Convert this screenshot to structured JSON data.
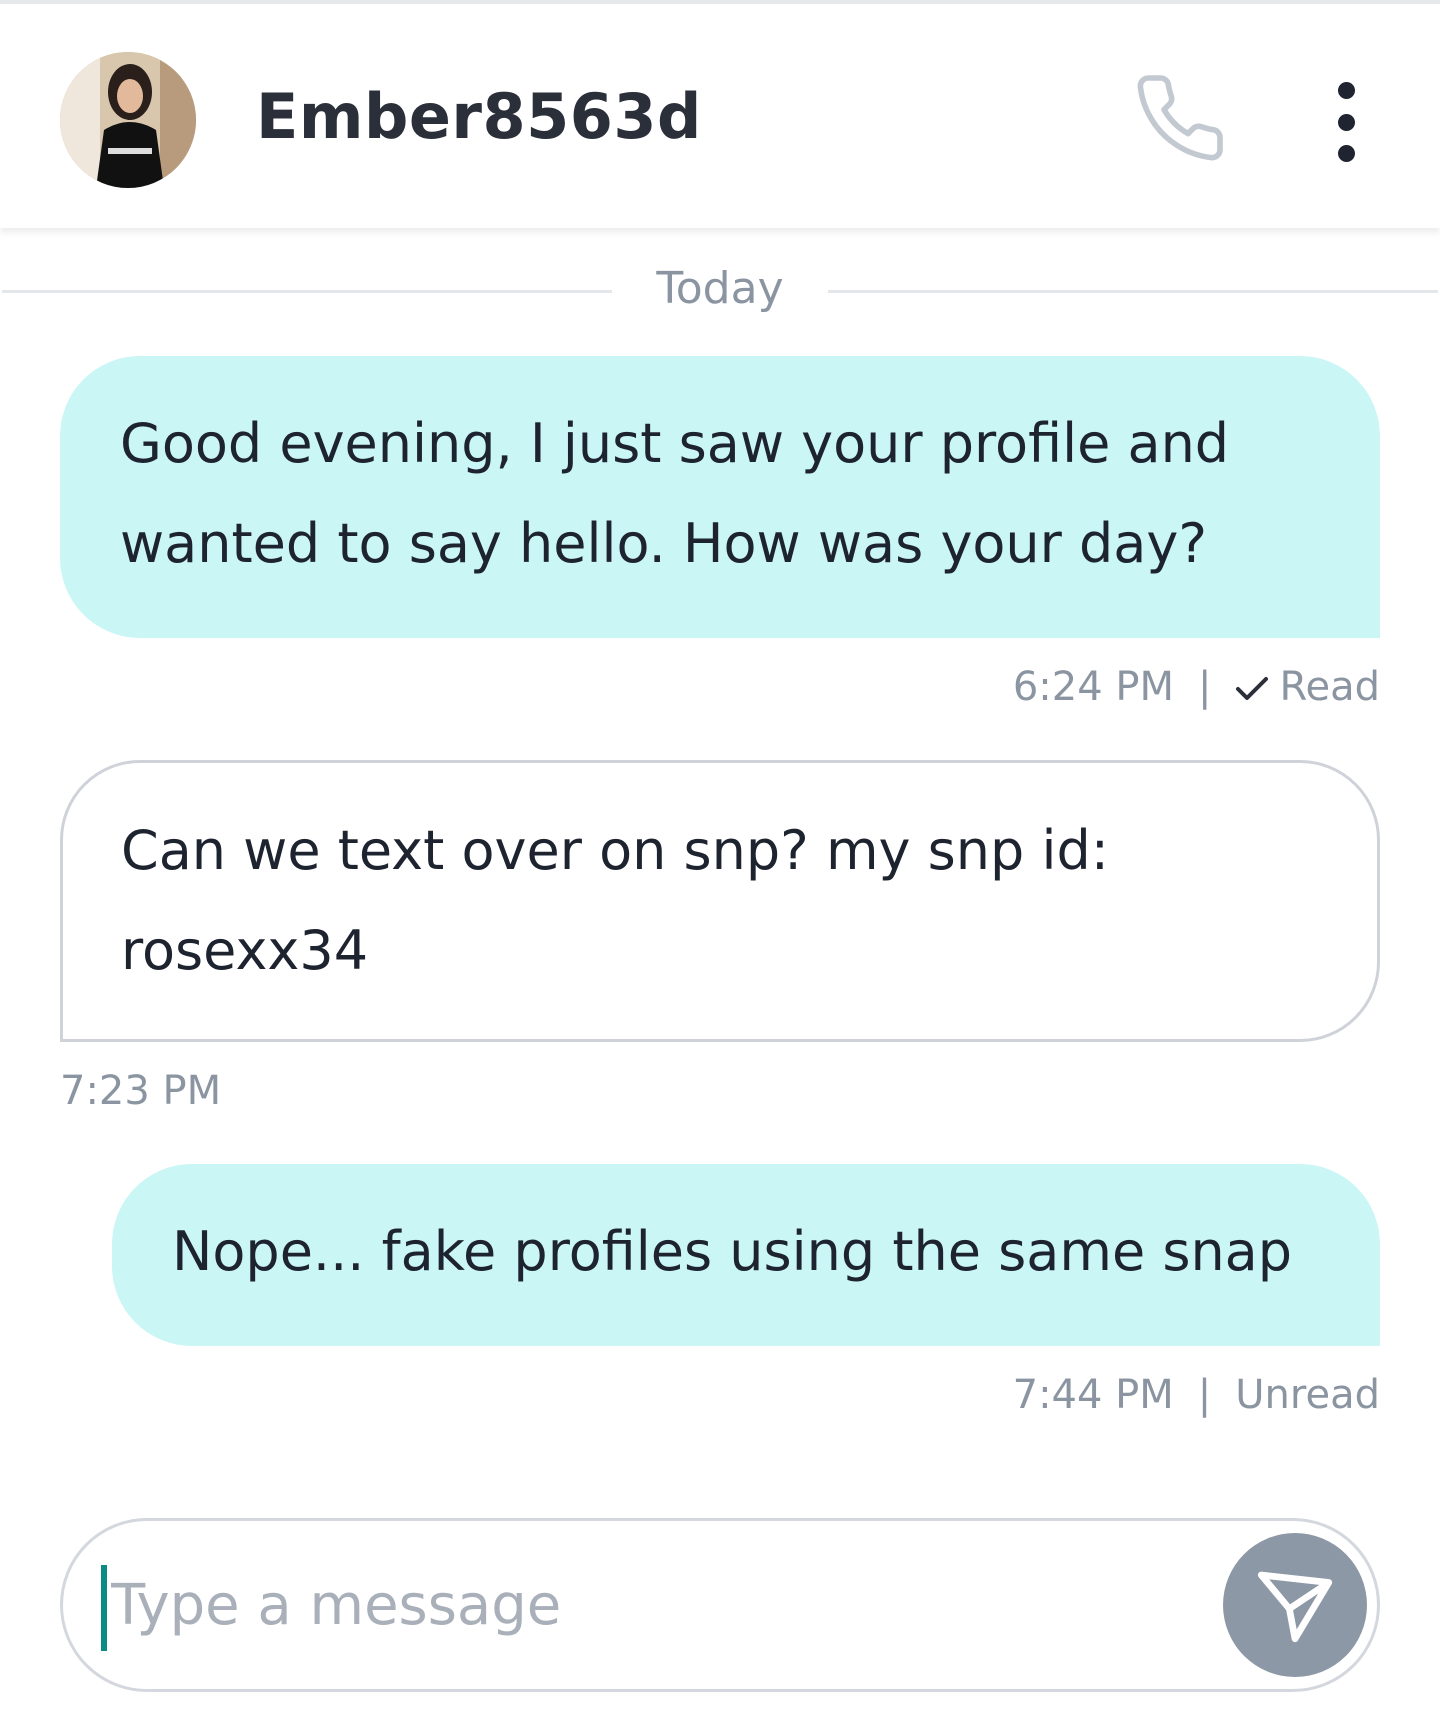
{
  "header": {
    "contact_name": "Ember8563d",
    "avatar_icon": "user-avatar-photo",
    "call_icon": "phone-icon",
    "menu_icon": "more-vertical-icon"
  },
  "date_separator": "Today",
  "messages": [
    {
      "direction": "outgoing",
      "lines": [
        "Good evening, I just saw your profile and",
        "wanted to say hello. How was your day?"
      ],
      "time": "6:24 PM",
      "status": "Read",
      "status_icon": "check-icon"
    },
    {
      "direction": "incoming",
      "lines": [
        "Can we text over on snp? my snp id:",
        "rosexx34"
      ],
      "time": "7:23 PM"
    },
    {
      "direction": "outgoing",
      "lines": [
        "Nope... fake profiles using the same snap"
      ],
      "time": "7:44 PM",
      "status": "Unread"
    }
  ],
  "separator_char": "|",
  "composer": {
    "placeholder": "Type a message",
    "value": "",
    "send_icon": "send-icon"
  },
  "colors": {
    "outgoing_bubble": "#caf6f6",
    "incoming_border": "#cfd3d9",
    "meta_text": "#8b95a1",
    "send_button": "#8d98a6",
    "caret": "#0e8a84"
  }
}
